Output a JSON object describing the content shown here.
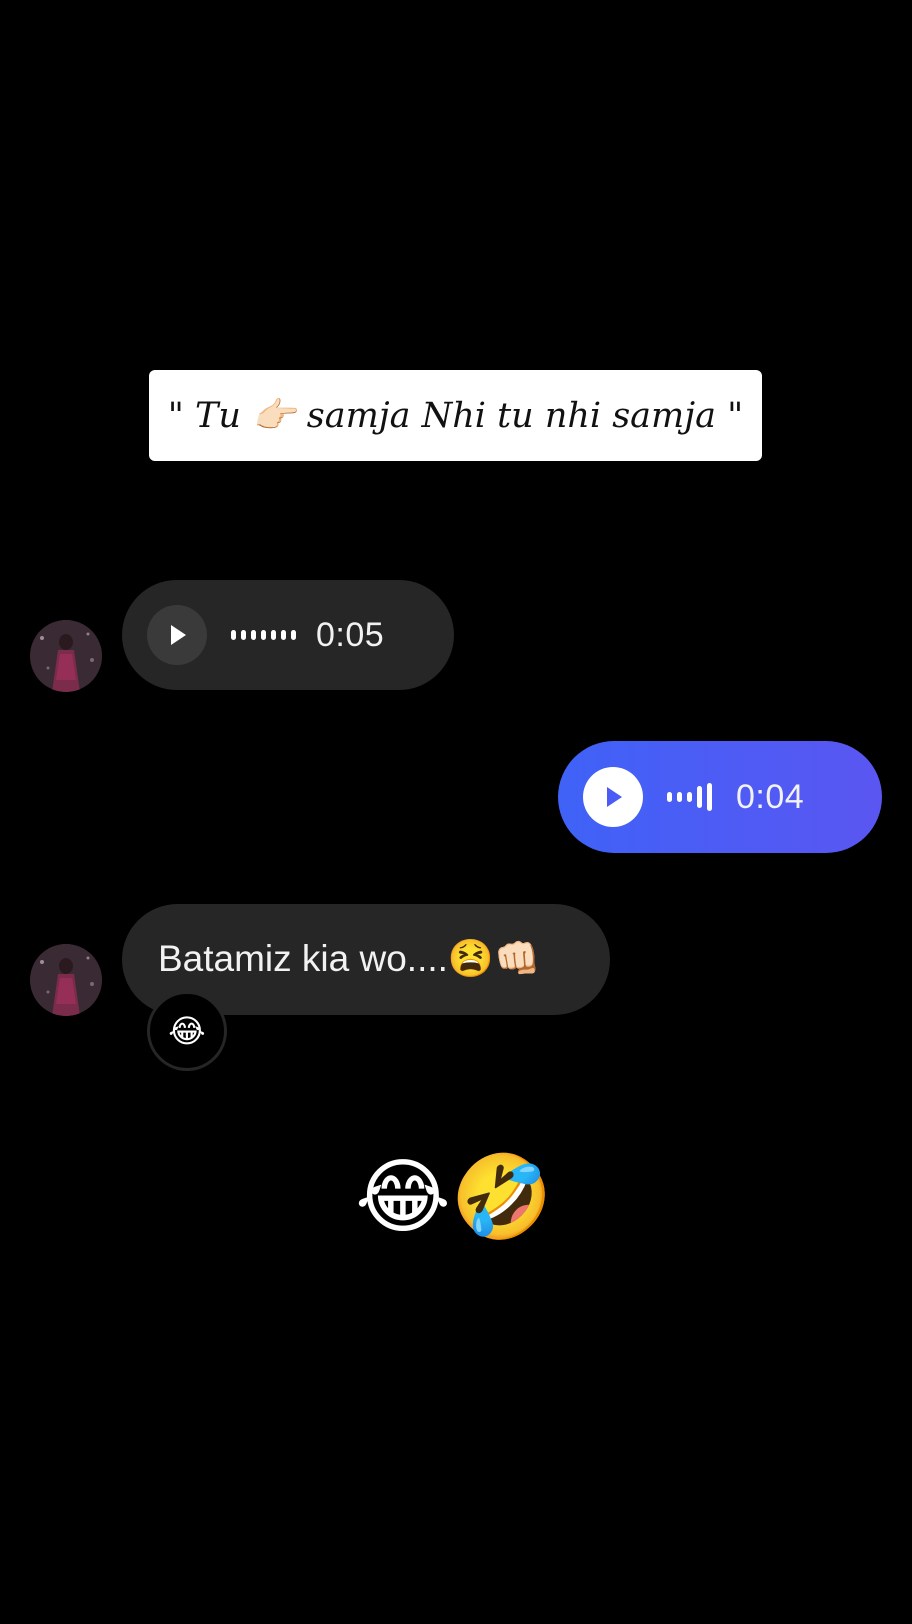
{
  "caption": "\" Tu 👉🏻 samja Nhi tu nhi samja \"",
  "messages": [
    {
      "type": "voice",
      "direction": "incoming",
      "duration": "0:05"
    },
    {
      "type": "voice",
      "direction": "outgoing",
      "duration": "0:04"
    },
    {
      "type": "text",
      "direction": "incoming",
      "text": "Batamiz kia wo....😫👊🏻",
      "reaction": "😂"
    }
  ],
  "footer_emojis": "😂🤣",
  "colors": {
    "background": "#000000",
    "incoming_bubble": "#262626",
    "outgoing_bubble": "#4a5cf5",
    "caption_bg": "#ffffff"
  },
  "icons": {
    "play": "play-icon",
    "waveform": "waveform-icon"
  }
}
